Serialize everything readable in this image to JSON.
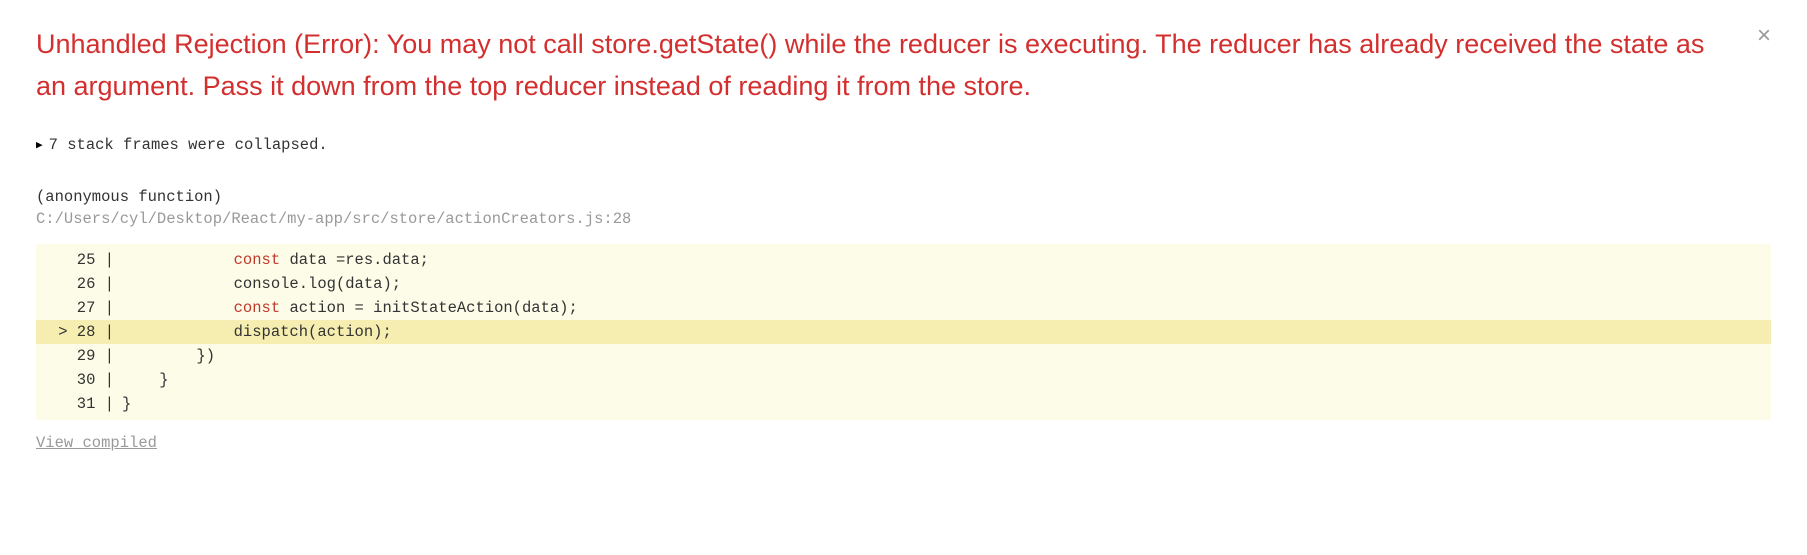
{
  "error": {
    "title": "Unhandled Rejection (Error): You may not call store.getState() while the reducer is executing. The reducer has already received the state as an argument. Pass it down from the top reducer instead of reading it from the store."
  },
  "close_label": "×",
  "collapsed": {
    "triangle": "▶",
    "text": "7 stack frames were collapsed."
  },
  "frame": {
    "function_name": "(anonymous function)",
    "file_path": "C:/Users/cyl/Desktop/React/my-app/src/store/actionCreators.js:28"
  },
  "code": {
    "lines": [
      {
        "marker": "  25 |",
        "indent": "            ",
        "kw": "const",
        "rest": " data =res.data;"
      },
      {
        "marker": "  26 |",
        "indent": "            ",
        "kw": "",
        "rest": "console.log(data);"
      },
      {
        "marker": "  27 |",
        "indent": "            ",
        "kw": "const",
        "rest": " action = initStateAction(data);"
      },
      {
        "marker": "> 28 |",
        "indent": "            ",
        "kw": "",
        "rest": "dispatch(action);",
        "highlight": true
      },
      {
        "marker": "  29 |",
        "indent": "        ",
        "kw": "",
        "rest": "})"
      },
      {
        "marker": "  30 |",
        "indent": "    ",
        "kw": "",
        "rest": "}"
      },
      {
        "marker": "  31 |",
        "indent": "",
        "kw": "",
        "rest": "}"
      }
    ]
  },
  "view_compiled": "View compiled"
}
